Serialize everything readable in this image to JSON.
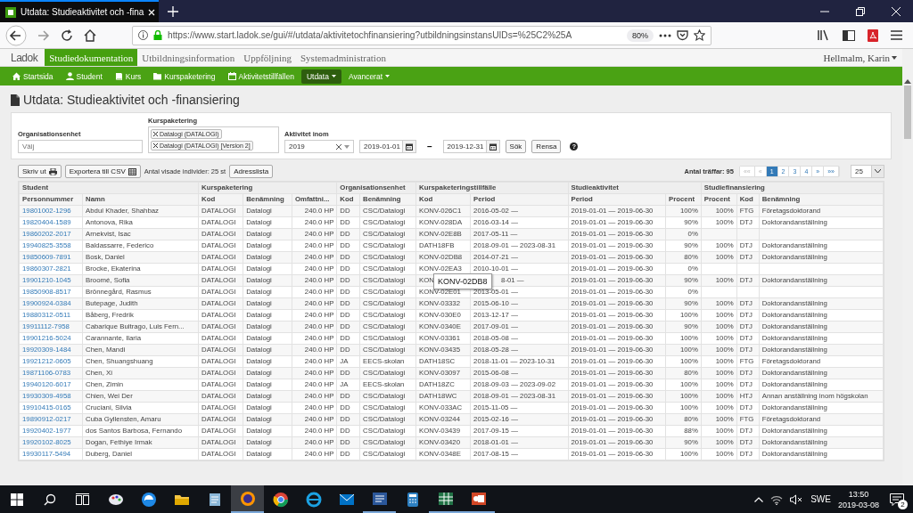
{
  "browser": {
    "tab_title": "Utdata: Studieaktivitet och -fina",
    "url": "https://www.start.ladok.se/gui/#/utdata/aktivitetochfinansiering?utbildningsinstansUIDs=%25C2%25A",
    "zoom": "80%"
  },
  "app": {
    "logo": "Ladok",
    "sections": [
      {
        "label": "Studiedokumentation",
        "selected": true
      },
      {
        "label": "Utbildningsinformation",
        "selected": false
      },
      {
        "label": "Uppföljning",
        "selected": false
      },
      {
        "label": "Systemadministration",
        "selected": false
      }
    ],
    "user": "Hellmalm, Karin",
    "menu": [
      {
        "label": "Startsida",
        "kind": "home",
        "selected": false,
        "dropdown": false
      },
      {
        "label": "Student",
        "kind": "user",
        "selected": false,
        "dropdown": false
      },
      {
        "label": "Kurs",
        "kind": "book",
        "selected": false,
        "dropdown": false
      },
      {
        "label": "Kurspaketering",
        "kind": "folder",
        "selected": false,
        "dropdown": false
      },
      {
        "label": "Aktivitetstillfällen",
        "kind": "calendar",
        "selected": false,
        "dropdown": false
      },
      {
        "label": "Utdata",
        "kind": "none",
        "selected": true,
        "dropdown": true
      },
      {
        "label": "Avancerat",
        "kind": "none",
        "selected": false,
        "dropdown": true
      }
    ]
  },
  "page_title": "Utdata: Studieaktivitet och -finansiering",
  "filters": {
    "org_label": "Organisationsenhet",
    "org_placeholder": "Välj",
    "kp_label": "Kurspaketering",
    "kp_tags": [
      "Datalogi (DATALOGI)",
      "Datalogi (DATALOGI) [Version 2]"
    ],
    "period_label": "Aktivitet inom",
    "year": "2019",
    "from": "2019-01-01",
    "dash": "–",
    "to": "2019-12-31",
    "buttons": [
      "Sök",
      "Rensa"
    ],
    "help": "?"
  },
  "toolbar": {
    "print": "Skriv ut",
    "export": "Exportera till CSV",
    "shown": "Antal visade individer: 25 st",
    "address": "Adresslista",
    "hits": "Antal träffar: 95",
    "page_size": "25",
    "pager": [
      {
        "label": "««",
        "selected": false,
        "disabled": true
      },
      {
        "label": "«",
        "selected": false,
        "disabled": true
      },
      {
        "label": "1",
        "selected": true,
        "disabled": false
      },
      {
        "label": "2",
        "selected": false,
        "disabled": false
      },
      {
        "label": "3",
        "selected": false,
        "disabled": false
      },
      {
        "label": "4",
        "selected": false,
        "disabled": false
      },
      {
        "label": "»",
        "selected": false,
        "disabled": false
      },
      {
        "label": "»»",
        "selected": false,
        "disabled": false
      }
    ]
  },
  "table": {
    "groups": [
      {
        "label": "Student",
        "columns": [
          "Personnummer",
          "Namn"
        ]
      },
      {
        "label": "Kurspaketering",
        "columns": [
          "Kod",
          "Benämning",
          "Omfattni..."
        ]
      },
      {
        "label": "Organisationsenhet",
        "columns": [
          "Kod",
          "Benämning"
        ]
      },
      {
        "label": "Kurspaketeringstillfälle",
        "columns": [
          "Kod",
          "Period"
        ]
      },
      {
        "label": "Studieaktivitet",
        "columns": [
          "Period",
          "Procent"
        ]
      },
      {
        "label": "Studiefinansiering",
        "columns": [
          "Procent",
          "Kod",
          "Benämning"
        ]
      }
    ],
    "rows": [
      {
        "cells": [
          "19801002-1296",
          "Abdul Khader, Shahbaz",
          "DATALOGI",
          "Datalogi",
          "240.0 HP",
          "DD",
          "CSC/Datalogi",
          "KONV-026C1",
          "2016-05-02 —",
          "2019-01-01 — 2019-06-30",
          "100%",
          "100%",
          "FTG",
          "Företagsdoktorand"
        ]
      },
      {
        "cells": [
          "19820404-1589",
          "Antonova, Rika",
          "DATALOGI",
          "Datalogi",
          "240.0 HP",
          "DD",
          "CSC/Datalogi",
          "KONV-028DA",
          "2016-03-14 —",
          "2019-01-01 — 2019-06-30",
          "90%",
          "100%",
          "DTJ",
          "Doktorandanställning"
        ]
      },
      {
        "cells": [
          "19860202-2017",
          "Arnekvist, Isac",
          "DATALOGI",
          "Datalogi",
          "240.0 HP",
          "DD",
          "CSC/Datalogi",
          "KONV-02E8B",
          "2017-05-11 —",
          "2019-01-01 — 2019-06-30",
          "0%",
          null,
          null,
          null
        ]
      },
      {
        "cells": [
          "19940825-3558",
          "Baldassarre, Federico",
          "DATALOGI",
          "Datalogi",
          "240.0 HP",
          "DD",
          "CSC/Datalogi",
          "DATH18FB",
          "2018-09-01 — 2023-08-31",
          "2019-01-01 — 2019-06-30",
          "90%",
          "100%",
          "DTJ",
          "Doktorandanställning"
        ]
      },
      {
        "cells": [
          "19850609-7891",
          "Bosk, Daniel",
          "DATALOGI",
          "Datalogi",
          "240.0 HP",
          "DD",
          "CSC/Datalogi",
          "KONV-02DB8",
          "2014-07-21 —",
          "2019-01-01 — 2019-06-30",
          "80%",
          "100%",
          "DTJ",
          "Doktorandanställning"
        ]
      },
      {
        "cells": [
          "19860307-2821",
          "Brocke, Ekaterina",
          "DATALOGI",
          "Datalogi",
          "240.0 HP",
          "DD",
          "CSC/Datalogi",
          "KONV-02EA3",
          "2010-10-01 —",
          "2019-01-01 — 2019-06-30",
          "0%",
          null,
          null,
          null
        ]
      },
      {
        "cells": [
          "19901210-1045",
          "Broomé, Sofia",
          "DATALOGI",
          "Datalogi",
          "240.0 HP",
          "DD",
          "CSC/Datalogi",
          "KON",
          "8-01 —",
          "2019-01-01 — 2019-06-30",
          "90%",
          "100%",
          "DTJ",
          "Doktorandanställning"
        ],
        "tooltip": "KONV-02DB8"
      },
      {
        "cells": [
          "19850908-8517",
          "Brönnegård, Rasmus",
          "DATALOGI",
          "Datalogi",
          "240.0 HP",
          "DD",
          "CSC/Datalogi",
          "KONV-02E01",
          "2013-05-01 —",
          "2019-01-01 — 2019-06-30",
          "0%",
          null,
          null,
          null
        ]
      },
      {
        "cells": [
          "19900924-0384",
          "Butepage, Judith",
          "DATALOGI",
          "Datalogi",
          "240.0 HP",
          "DD",
          "CSC/Datalogi",
          "KONV-03332",
          "2015-06-10 —",
          "2019-01-01 — 2019-06-30",
          "90%",
          "100%",
          "DTJ",
          "Doktorandanställning"
        ]
      },
      {
        "cells": [
          "19880312-0511",
          "Båberg, Fredrik",
          "DATALOGI",
          "Datalogi",
          "240.0 HP",
          "DD",
          "CSC/Datalogi",
          "KONV-030E0",
          "2013-12-17 —",
          "2019-01-01 — 2019-06-30",
          "100%",
          "100%",
          "DTJ",
          "Doktorandanställning"
        ]
      },
      {
        "cells": [
          "19911112-7958",
          "Cabarique Buitrago, Luis Fern...",
          "DATALOGI",
          "Datalogi",
          "240.0 HP",
          "DD",
          "CSC/Datalogi",
          "KONV-0340E",
          "2017-09-01 —",
          "2019-01-01 — 2019-06-30",
          "90%",
          "100%",
          "DTJ",
          "Doktorandanställning"
        ]
      },
      {
        "cells": [
          "19901216-5024",
          "Carannante, Ilaria",
          "DATALOGI",
          "Datalogi",
          "240.0 HP",
          "DD",
          "CSC/Datalogi",
          "KONV-03361",
          "2018-05-08 —",
          "2019-01-01 — 2019-06-30",
          "100%",
          "100%",
          "DTJ",
          "Doktorandanställning"
        ]
      },
      {
        "cells": [
          "19920309-1484",
          "Chen, Mandi",
          "DATALOGI",
          "Datalogi",
          "240.0 HP",
          "DD",
          "CSC/Datalogi",
          "KONV-03435",
          "2018-05-28 —",
          "2019-01-01 — 2019-06-30",
          "100%",
          "100%",
          "DTJ",
          "Doktorandanställning"
        ]
      },
      {
        "cells": [
          "19921212-0605",
          "Chen, Shuangshuang",
          "DATALOGI",
          "Datalogi",
          "240.0 HP",
          "JA",
          "EECS-skolan",
          "DATH18SC",
          "2018-11-01 — 2023-10-31",
          "2019-01-01 — 2019-06-30",
          "100%",
          "100%",
          "FTG",
          "Företagsdoktorand"
        ]
      },
      {
        "cells": [
          "19871106-0783",
          "Chen, Xi",
          "DATALOGI",
          "Datalogi",
          "240.0 HP",
          "DD",
          "CSC/Datalogi",
          "KONV-03097",
          "2015-06-08 —",
          "2019-01-01 — 2019-06-30",
          "80%",
          "100%",
          "DTJ",
          "Doktorandanställning"
        ]
      },
      {
        "cells": [
          "19940120-6017",
          "Chen, Zimin",
          "DATALOGI",
          "Datalogi",
          "240.0 HP",
          "JA",
          "EECS-skolan",
          "DATH18ZC",
          "2018-09-03 — 2023-09-02",
          "2019-01-01 — 2019-06-30",
          "100%",
          "100%",
          "DTJ",
          "Doktorandanställning"
        ]
      },
      {
        "cells": [
          "19930309-4958",
          "Chien, Wei Der",
          "DATALOGI",
          "Datalogi",
          "240.0 HP",
          "DD",
          "CSC/Datalogi",
          "DATH18WC",
          "2018-09-01 — 2023-08-31",
          "2019-01-01 — 2019-06-30",
          "100%",
          "100%",
          "HTJ",
          "Annan anställning inom högskolan"
        ]
      },
      {
        "cells": [
          "19910415-0165",
          "Cruciani, Silvia",
          "DATALOGI",
          "Datalogi",
          "240.0 HP",
          "DD",
          "CSC/Datalogi",
          "KONV-033AC",
          "2015-11-05 —",
          "2019-01-01 — 2019-06-30",
          "100%",
          "100%",
          "DTJ",
          "Doktorandanställning"
        ]
      },
      {
        "cells": [
          "19890912-0217",
          "Cuba Gyllensten, Amaru",
          "DATALOGI",
          "Datalogi",
          "240.0 HP",
          "DD",
          "CSC/Datalogi",
          "KONV-03244",
          "2015-02-16 —",
          "2019-01-01 — 2019-06-30",
          "80%",
          "100%",
          "FTG",
          "Företagsdoktorand"
        ]
      },
      {
        "cells": [
          "19920402-1977",
          "dos Santos Barbosa, Fernando",
          "DATALOGI",
          "Datalogi",
          "240.0 HP",
          "DD",
          "CSC/Datalogi",
          "KONV-03439",
          "2017-09-15 —",
          "2019-01-01 — 2019-06-30",
          "88%",
          "100%",
          "DTJ",
          "Doktorandanställning"
        ]
      },
      {
        "cells": [
          "19920102-8025",
          "Dogan, Fethiye Irmak",
          "DATALOGI",
          "Datalogi",
          "240.0 HP",
          "DD",
          "CSC/Datalogi",
          "KONV-03420",
          "2018-01-01 —",
          "2019-01-01 — 2019-06-30",
          "90%",
          "100%",
          "DTJ",
          "Doktorandanställning"
        ]
      },
      {
        "cells": [
          "19930117-5494",
          "Duberg, Daniel",
          "DATALOGI",
          "Datalogi",
          "240.0 HP",
          "DD",
          "CSC/Datalogi",
          "KONV-0348E",
          "2017-08-15 —",
          "2019-01-01 — 2019-06-30",
          "100%",
          "100%",
          "DTJ",
          "Doktorandanställning"
        ]
      }
    ]
  },
  "taskbar": {
    "apps": [
      {
        "kind": "paint",
        "selected": false,
        "running": false
      },
      {
        "kind": "edge",
        "selected": false,
        "running": false
      },
      {
        "kind": "explorer",
        "selected": false,
        "running": false
      },
      {
        "kind": "notes",
        "selected": false,
        "running": false
      },
      {
        "kind": "firefox",
        "selected": true,
        "running": true
      },
      {
        "kind": "chrome",
        "selected": false,
        "running": false
      },
      {
        "kind": "ie",
        "selected": false,
        "running": false
      },
      {
        "kind": "outlook",
        "selected": false,
        "running": false
      },
      {
        "kind": "word",
        "selected": false,
        "running": true
      },
      {
        "kind": "calculator",
        "selected": false,
        "running": false
      },
      {
        "kind": "excel",
        "selected": false,
        "running": true
      },
      {
        "kind": "powerpoint",
        "selected": false,
        "running": true
      }
    ],
    "language": "SWE",
    "time": "13:50",
    "date": "2019-03-08",
    "notifications": "2"
  }
}
